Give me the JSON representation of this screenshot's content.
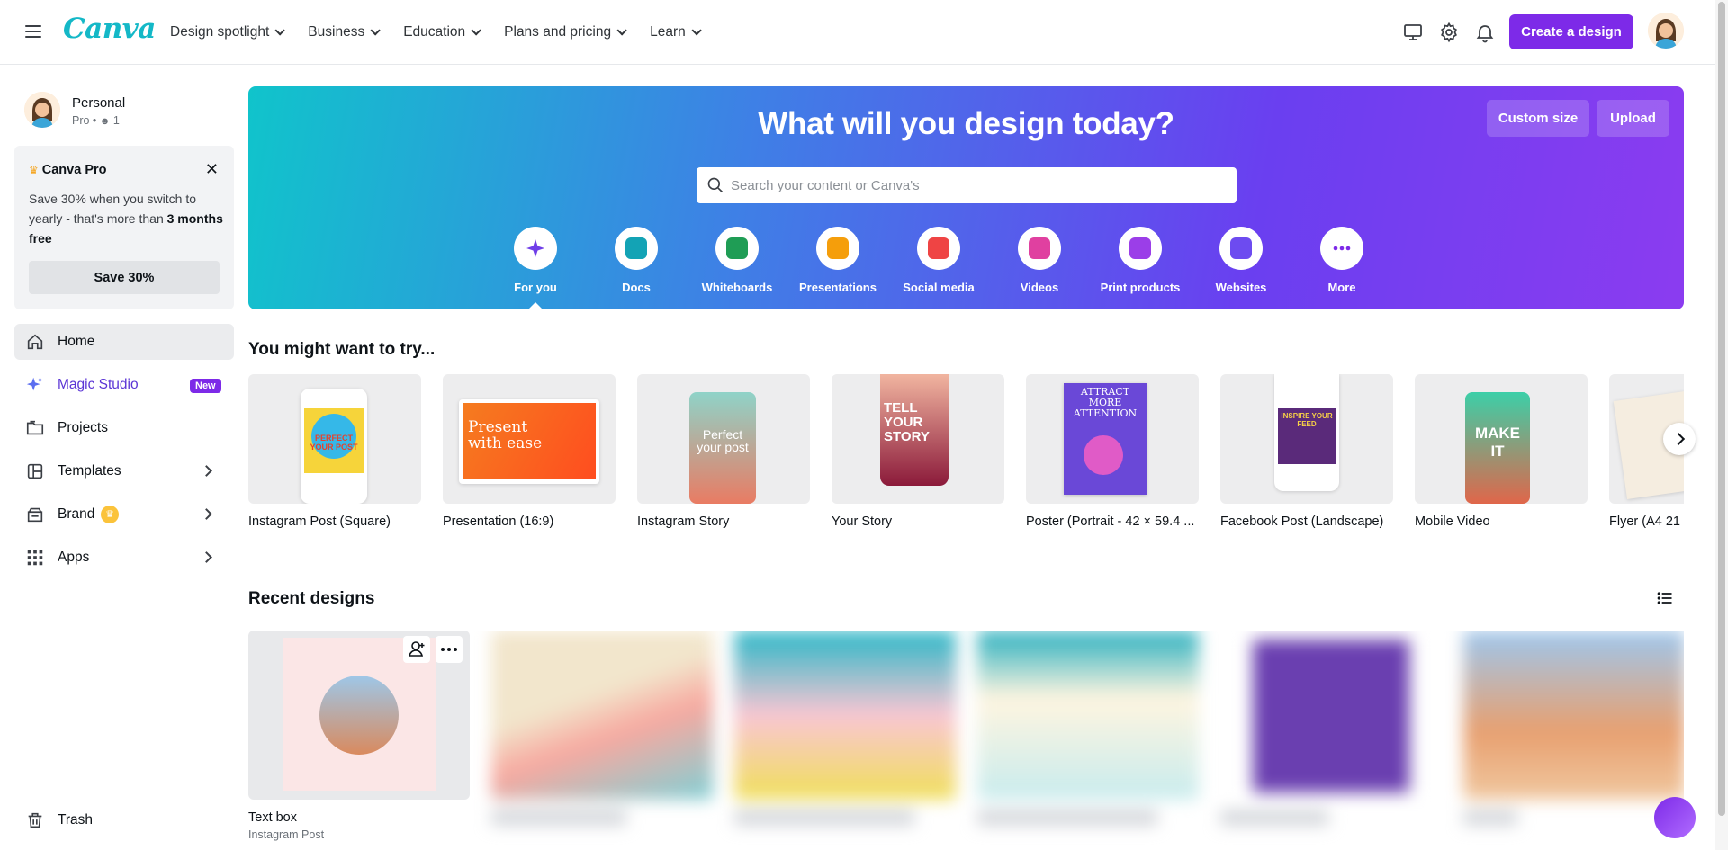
{
  "topbar": {
    "logo": "Canva",
    "nav": [
      "Design spotlight",
      "Business",
      "Education",
      "Plans and pricing",
      "Learn"
    ],
    "create_label": "Create a design"
  },
  "sidebar": {
    "profile_name": "Personal",
    "profile_sub": "Pro • ",
    "profile_members": "1",
    "promo": {
      "title": "Canva Pro",
      "body_plain": "Save 30% when you switch to yearly - that's more than ",
      "body_bold": "3 months free",
      "button": "Save 30%"
    },
    "items": [
      {
        "label": "Home"
      },
      {
        "label": "Magic Studio",
        "badge": "New"
      },
      {
        "label": "Projects"
      },
      {
        "label": "Templates"
      },
      {
        "label": "Brand"
      },
      {
        "label": "Apps"
      }
    ],
    "trash": "Trash"
  },
  "hero": {
    "title": "What will you design today?",
    "custom_size": "Custom size",
    "upload": "Upload",
    "search_placeholder": "Search your content or Canva's",
    "categories": [
      {
        "label": "For you",
        "color": "#6f3ee8"
      },
      {
        "label": "Docs",
        "color": "#13a3b5"
      },
      {
        "label": "Whiteboards",
        "color": "#1f9d55"
      },
      {
        "label": "Presentations",
        "color": "#f59e0b"
      },
      {
        "label": "Social media",
        "color": "#ef4444"
      },
      {
        "label": "Videos",
        "color": "#e040a0"
      },
      {
        "label": "Print products",
        "color": "#9b3ee8"
      },
      {
        "label": "Websites",
        "color": "#6d4bf0"
      },
      {
        "label": "More",
        "color": "#7d2ae8"
      }
    ]
  },
  "try": {
    "title": "You might want to try...",
    "items": [
      {
        "label": "Instagram Post (Square)",
        "thumb_text": "PERFECT YOUR POST"
      },
      {
        "label": "Presentation (16:9)",
        "thumb_text": "Present with ease"
      },
      {
        "label": "Instagram Story",
        "thumb_text": "Perfect your post"
      },
      {
        "label": "Your Story",
        "thumb_text": "TELL YOUR STORY"
      },
      {
        "label": "Poster (Portrait - 42 × 59.4 ...",
        "thumb_text": "ATTRACT MORE ATTENTION"
      },
      {
        "label": "Facebook Post (Landscape)",
        "thumb_text": "INSPIRE YOUR FEED"
      },
      {
        "label": "Mobile Video",
        "thumb_text": "MAKE IT"
      },
      {
        "label": "Flyer (A4 21",
        "thumb_text": ""
      }
    ]
  },
  "recent": {
    "title": "Recent designs",
    "items": [
      {
        "title": "Text box",
        "sub": "Instagram Post"
      },
      {
        "title": "",
        "sub": ""
      },
      {
        "title": "",
        "sub": ""
      },
      {
        "title": "",
        "sub": ""
      },
      {
        "title": "",
        "sub": ""
      },
      {
        "title": "",
        "sub": ""
      }
    ]
  }
}
